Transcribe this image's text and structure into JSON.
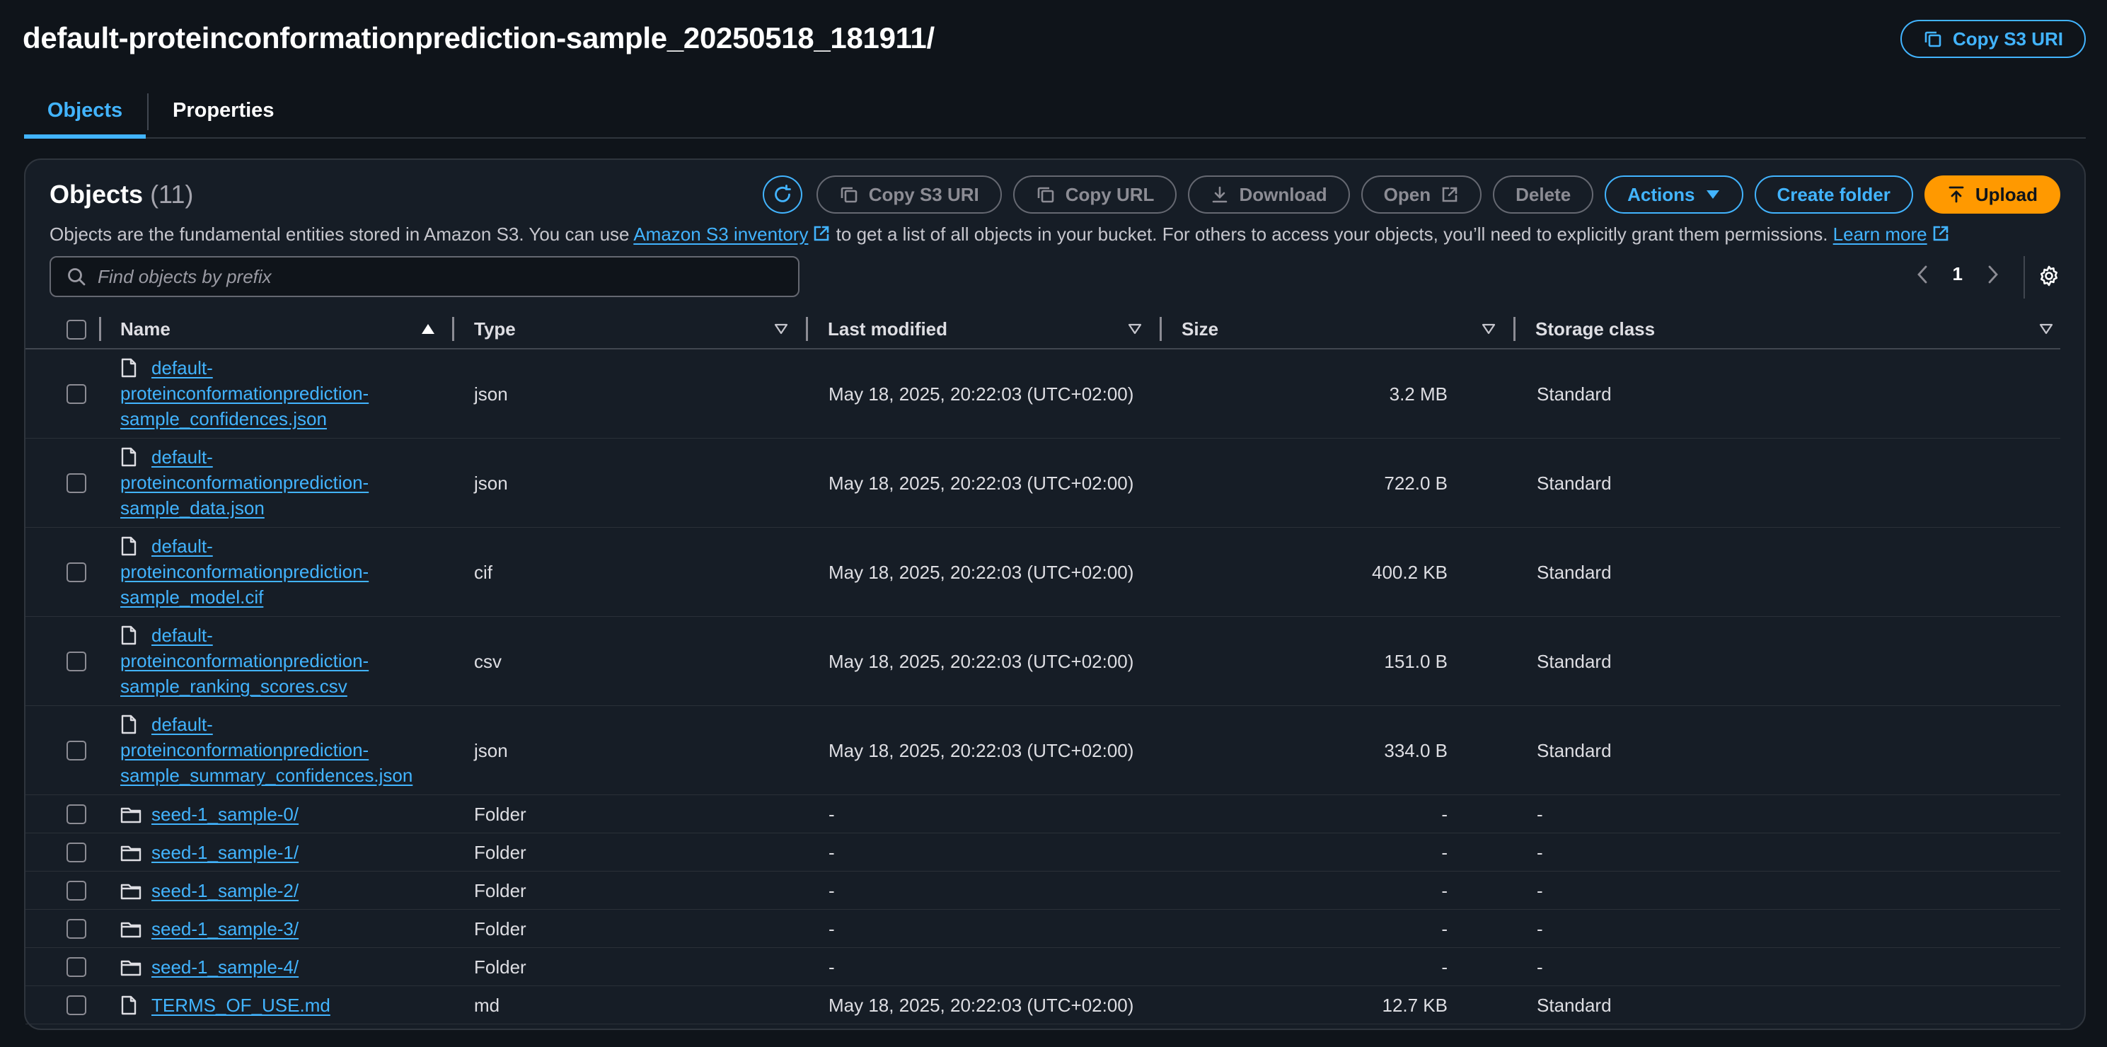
{
  "header": {
    "title": "default-proteinconformationprediction-sample_20250518_181911/",
    "copy_s3_uri": "Copy S3 URI"
  },
  "tabs": [
    {
      "label": "Objects",
      "active": true
    },
    {
      "label": "Properties",
      "active": false
    }
  ],
  "objects_panel": {
    "title": "Objects",
    "count": "(11)",
    "toolbar": {
      "copy_s3_uri": "Copy S3 URI",
      "copy_url": "Copy URL",
      "download": "Download",
      "open": "Open",
      "delete": "Delete",
      "actions": "Actions",
      "create_folder": "Create folder",
      "upload": "Upload"
    },
    "description": {
      "before": "Objects are the fundamental entities stored in Amazon S3. You can use ",
      "inventory_link": "Amazon S3 inventory",
      "middle": " to get a list of all objects in your bucket. For others to access your objects, you’ll need to explicitly grant them permissions. ",
      "learn_more": "Learn more"
    },
    "search": {
      "placeholder": "Find objects by prefix",
      "value": ""
    },
    "pagination": {
      "current_page": "1"
    },
    "columns": [
      "Name",
      "Type",
      "Last modified",
      "Size",
      "Storage class"
    ],
    "rows": [
      {
        "kind": "file",
        "name_lines": [
          "default-",
          "proteinconformationprediction-",
          "sample_confidences.json"
        ],
        "type": "json",
        "last_modified": "May 18, 2025, 20:22:03 (UTC+02:00)",
        "size": "3.2 MB",
        "storage_class": "Standard"
      },
      {
        "kind": "file",
        "name_lines": [
          "default-",
          "proteinconformationprediction-",
          "sample_data.json"
        ],
        "type": "json",
        "last_modified": "May 18, 2025, 20:22:03 (UTC+02:00)",
        "size": "722.0 B",
        "storage_class": "Standard"
      },
      {
        "kind": "file",
        "name_lines": [
          "default-",
          "proteinconformationprediction-",
          "sample_model.cif"
        ],
        "type": "cif",
        "last_modified": "May 18, 2025, 20:22:03 (UTC+02:00)",
        "size": "400.2 KB",
        "storage_class": "Standard"
      },
      {
        "kind": "file",
        "name_lines": [
          "default-",
          "proteinconformationprediction-",
          "sample_ranking_scores.csv"
        ],
        "type": "csv",
        "last_modified": "May 18, 2025, 20:22:03 (UTC+02:00)",
        "size": "151.0 B",
        "storage_class": "Standard"
      },
      {
        "kind": "file",
        "name_lines": [
          "default-",
          "proteinconformationprediction-",
          "sample_summary_confidences.json"
        ],
        "type": "json",
        "last_modified": "May 18, 2025, 20:22:03 (UTC+02:00)",
        "size": "334.0 B",
        "storage_class": "Standard"
      },
      {
        "kind": "folder",
        "name_lines": [
          "seed-1_sample-0/"
        ],
        "type": "Folder",
        "last_modified": "-",
        "size": "-",
        "storage_class": "-"
      },
      {
        "kind": "folder",
        "name_lines": [
          "seed-1_sample-1/"
        ],
        "type": "Folder",
        "last_modified": "-",
        "size": "-",
        "storage_class": "-"
      },
      {
        "kind": "folder",
        "name_lines": [
          "seed-1_sample-2/"
        ],
        "type": "Folder",
        "last_modified": "-",
        "size": "-",
        "storage_class": "-"
      },
      {
        "kind": "folder",
        "name_lines": [
          "seed-1_sample-3/"
        ],
        "type": "Folder",
        "last_modified": "-",
        "size": "-",
        "storage_class": "-"
      },
      {
        "kind": "folder",
        "name_lines": [
          "seed-1_sample-4/"
        ],
        "type": "Folder",
        "last_modified": "-",
        "size": "-",
        "storage_class": "-"
      },
      {
        "kind": "file",
        "name_lines": [
          "TERMS_OF_USE.md"
        ],
        "type": "md",
        "last_modified": "May 18, 2025, 20:22:03 (UTC+02:00)",
        "size": "12.7 KB",
        "storage_class": "Standard"
      }
    ]
  },
  "colors": {
    "background": "#0f141a",
    "panel": "#161d26",
    "link_blue": "#42b4ff",
    "primary_orange": "#ff9900"
  }
}
